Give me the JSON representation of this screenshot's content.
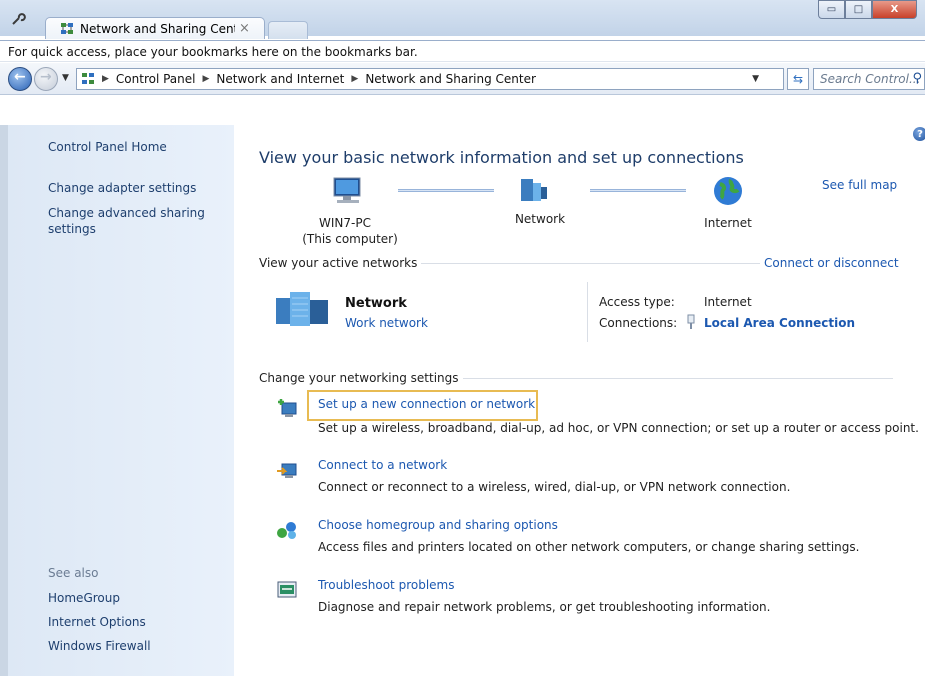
{
  "browser": {
    "tab_title": "Network and Sharing Cent",
    "tab_close": "×",
    "bookmarks_hint": "For quick access, place your bookmarks here on the bookmarks bar.",
    "window_buttons": {
      "minimize": "▭",
      "maximize": "□",
      "close": "X"
    }
  },
  "address": {
    "breadcrumbs": [
      "Control Panel",
      "Network and Internet",
      "Network and Sharing Center"
    ],
    "search_placeholder": "Search Control..."
  },
  "sidebar": {
    "home": "Control Panel Home",
    "links": [
      "Change adapter settings",
      "Change advanced sharing",
      "settings"
    ],
    "see_also_label": "See also",
    "see_also": [
      "HomeGroup",
      "Internet Options",
      "Windows Firewall"
    ]
  },
  "main": {
    "heading": "View your basic network information and set up connections",
    "see_full_map": "See full map",
    "map": {
      "computer_name": "WIN7-PC",
      "computer_sub": "(This computer)",
      "network_label": "Network",
      "internet_label": "Internet"
    },
    "active_networks_label": "View your active networks",
    "connect_disconnect": "Connect or disconnect",
    "active_network": {
      "name": "Network",
      "type": "Work network",
      "access_type_label": "Access type:",
      "access_type_value": "Internet",
      "connections_label": "Connections:",
      "connections_value": "Local Area Connection"
    },
    "settings_label": "Change your networking settings",
    "tasks": [
      {
        "title": "Set up a new connection or network",
        "desc": "Set up a wireless, broadband, dial-up, ad hoc, or VPN connection; or set up a router or access point."
      },
      {
        "title": "Connect to a network",
        "desc": "Connect or reconnect to a wireless, wired, dial-up, or VPN network connection."
      },
      {
        "title": "Choose homegroup and sharing options",
        "desc": "Access files and printers located on other network computers, or change sharing settings."
      },
      {
        "title": "Troubleshoot problems",
        "desc": "Diagnose and repair network problems, or get troubleshooting information."
      }
    ],
    "help": "?"
  },
  "colors": {
    "link": "#1c58b0",
    "heading": "#1e3d6a",
    "highlight": "#e8bb52",
    "sidebar": "#dde8f5"
  }
}
